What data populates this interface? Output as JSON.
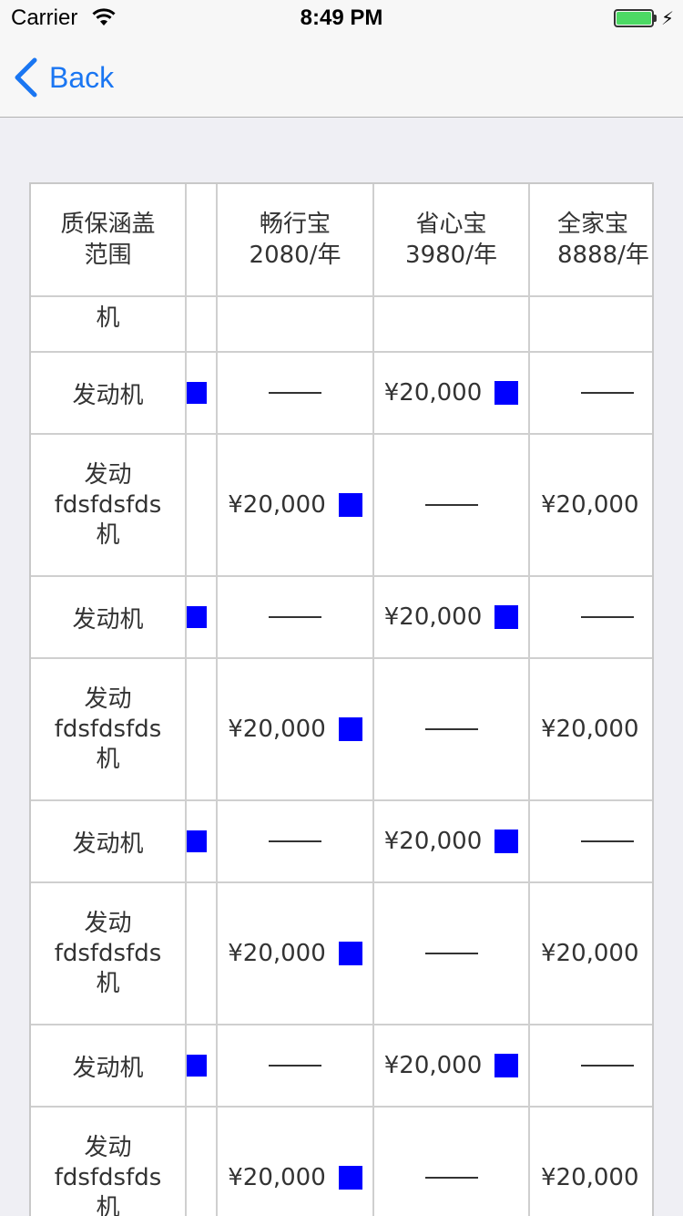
{
  "status_bar": {
    "carrier": "Carrier",
    "time": "8:49 PM"
  },
  "nav": {
    "back_label": "Back"
  },
  "table": {
    "header": {
      "coverage": "质保涵盖\n范围",
      "plan1": "畅行宝\n2080/年",
      "plan2": "省心宝\n3980/年",
      "plan3": "全家宝\n8888/年"
    },
    "partial_row_label": "机",
    "rows": [
      {
        "type": "short",
        "label": "发动机",
        "p1": "",
        "p2": "¥20,000",
        "p3": ""
      },
      {
        "type": "tall",
        "label": "发动\nfdsfdsfds\n机",
        "p1": "¥20,000",
        "p2": "",
        "p3": "¥20,000"
      },
      {
        "type": "short",
        "label": "发动机",
        "p1": "",
        "p2": "¥20,000",
        "p3": ""
      },
      {
        "type": "tall",
        "label": "发动\nfdsfdsfds\n机",
        "p1": "¥20,000",
        "p2": "",
        "p3": "¥20,000"
      },
      {
        "type": "short",
        "label": "发动机",
        "p1": "",
        "p2": "¥20,000",
        "p3": ""
      },
      {
        "type": "tall",
        "label": "发动\nfdsfdsfds\n机",
        "p1": "¥20,000",
        "p2": "",
        "p3": "¥20,000"
      },
      {
        "type": "short",
        "label": "发动机",
        "p1": "",
        "p2": "¥20,000",
        "p3": ""
      },
      {
        "type": "tall",
        "label": "发动\nfdsfdsfds\n机",
        "p1": "¥20,000",
        "p2": "",
        "p3": "¥20,000"
      }
    ]
  },
  "colors": {
    "marker": "#0000ff",
    "link": "#1a76f2",
    "battery": "#4cd964"
  }
}
